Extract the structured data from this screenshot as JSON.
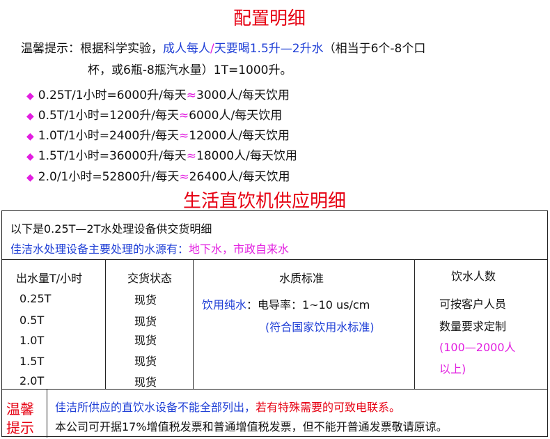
{
  "config": {
    "title": "配置明细",
    "tip": {
      "prefix": "温馨提示：根据科学实验，",
      "highlight_a": "成人每人",
      "slash": "/",
      "highlight_b": "天要喝1.5升—2升水",
      "suffix_line1": "（相当于6个-8个口",
      "line2": "杯，或6瓶-8瓶汽水量）1T=1000升。"
    },
    "items": [
      {
        "left": "0.25T/1小时=6000升/每天",
        "approx": "≈",
        "right": "3000人/每天饮用"
      },
      {
        "left": "0.5T/1小时=1200升/每天",
        "approx": "≈",
        "right": "6000人/每天饮用"
      },
      {
        "left": "1.0T/1小时=2400升/每天",
        "approx": "≈",
        "right": "12000人/每天饮用"
      },
      {
        "left": "1.5T/1小时=36000升/每天",
        "approx": "≈",
        "right": "18000人/每天饮用"
      },
      {
        "left": "2.0/1小时=52800升/每天",
        "approx": "≈",
        "right": "26400人/每天饮用"
      }
    ],
    "bullet_icon": "diamond-icon"
  },
  "supply": {
    "title": "生活直饮机供应明细",
    "intro": "以下是0.25T—2T水处理设备供交货明细",
    "source_label": "佳洁水处理设备主要处理的水源有：",
    "source_value": "地下水，市政自来水",
    "headers": {
      "output": "出水量T/小时",
      "delivery": "交货状态",
      "quality": "水质标准",
      "people": "饮水人数"
    },
    "outputs": [
      "0.25T",
      "0.5T",
      "1.0T",
      "1.5T",
      "2.0T"
    ],
    "statuses": [
      "现货",
      "现货",
      "现货",
      "现货",
      "现货"
    ],
    "quality": {
      "type": "饮用纯水",
      "conductivity": "：电导率：1~10 us/cm",
      "standard": "(符合国家饮用水标准)"
    },
    "people": {
      "line1": "可按客户人员",
      "line2": "数量要求定制",
      "range_line1": "(100—2000人",
      "range_line2": "以上)"
    },
    "notice": {
      "label_line1": "温馨",
      "label_line2": "提示",
      "line1_a": "佳洁所供应的直饮水设备不能全部列出，",
      "line1_b": "若有特殊需要的可致电联系。",
      "line2": "本公司可开据17%增值税发票和普通增值税发票，但不能开普通发票敬请原谅。"
    }
  },
  "colors": {
    "title_red": "#e60012",
    "blue": "#1f3fd6",
    "pink": "#e21ee0"
  }
}
